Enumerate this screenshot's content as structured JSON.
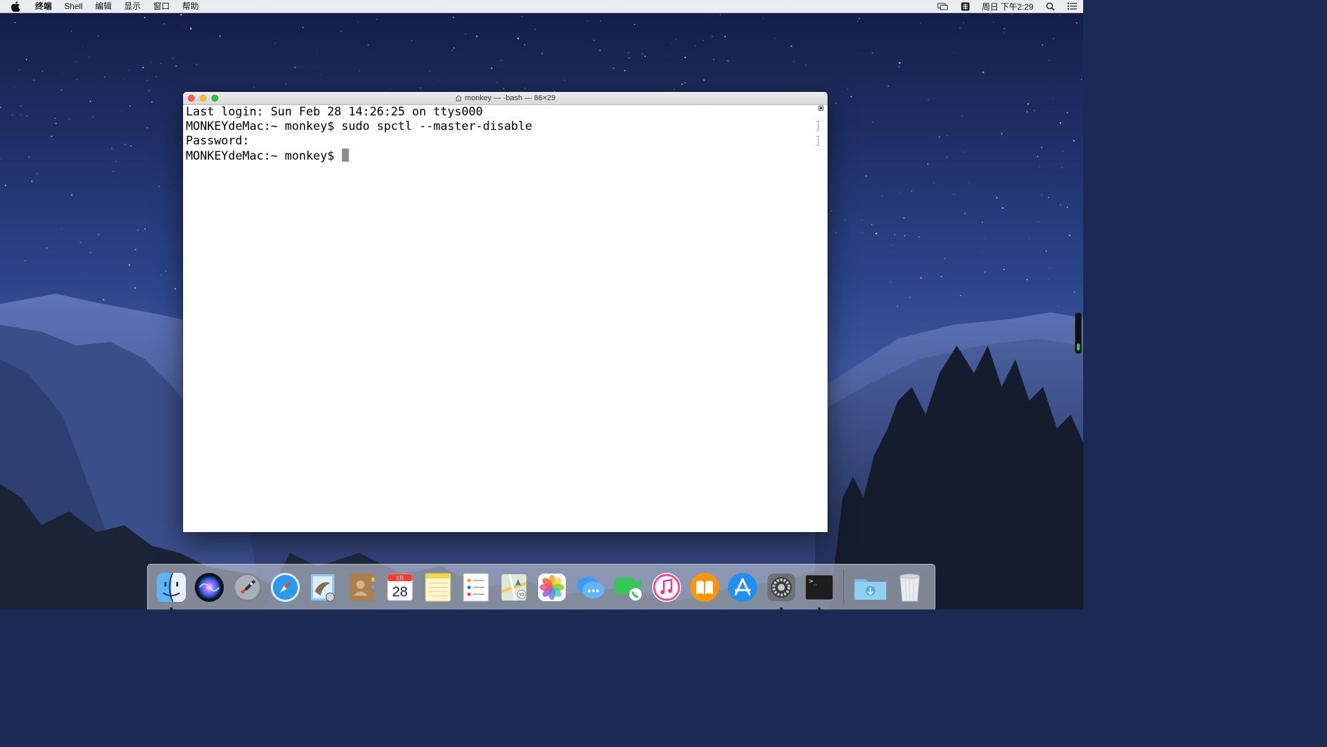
{
  "menubar": {
    "app_name": "终端",
    "menus": [
      "Shell",
      "编辑",
      "显示",
      "窗口",
      "帮助"
    ],
    "clock": "周日 下午2:29",
    "status_icons": [
      "display-mirroring-icon",
      "input-method-icon",
      "spotlight-search-icon",
      "notification-center-icon"
    ]
  },
  "terminal": {
    "title": "monkey — -bash — 86×29",
    "lines": [
      "Last login: Sun Feb 28 14:26:25 on ttys000",
      "MONKEYdeMac:~ monkey$ sudo spctl --master-disable",
      "Password:",
      "MONKEYdeMac:~ monkey$ "
    ]
  },
  "dock": {
    "apps": [
      {
        "name": "Finder",
        "icon": "finder-icon",
        "running": true
      },
      {
        "name": "Siri",
        "icon": "siri-icon",
        "running": false
      },
      {
        "name": "Launchpad",
        "icon": "launchpad-icon",
        "running": false
      },
      {
        "name": "Safari",
        "icon": "safari-icon",
        "running": false
      },
      {
        "name": "Mail",
        "icon": "mail-icon",
        "running": false
      },
      {
        "name": "Contacts",
        "icon": "contacts-icon",
        "running": false
      },
      {
        "name": "Calendar",
        "icon": "calendar-icon",
        "running": false,
        "month": "2月",
        "day": "28"
      },
      {
        "name": "Notes",
        "icon": "notes-icon",
        "running": false
      },
      {
        "name": "Reminders",
        "icon": "reminders-icon",
        "running": false
      },
      {
        "name": "Maps",
        "icon": "maps-icon",
        "running": false,
        "badge": "3D"
      },
      {
        "name": "Photos",
        "icon": "photos-icon",
        "running": false
      },
      {
        "name": "Messages",
        "icon": "messages-icon",
        "running": false
      },
      {
        "name": "FaceTime",
        "icon": "facetime-icon",
        "running": false
      },
      {
        "name": "iTunes",
        "icon": "itunes-icon",
        "running": false
      },
      {
        "name": "iBooks",
        "icon": "ibooks-icon",
        "running": false
      },
      {
        "name": "App Store",
        "icon": "app-store-icon",
        "running": false
      },
      {
        "name": "System Preferences",
        "icon": "system-preferences-icon",
        "running": true
      },
      {
        "name": "Terminal",
        "icon": "terminal-icon",
        "running": true,
        "glyph": ">_"
      }
    ],
    "stacks": [
      {
        "name": "Downloads",
        "icon": "downloads-folder-icon"
      },
      {
        "name": "Trash",
        "icon": "trash-icon"
      }
    ]
  },
  "colors": {
    "close": "#fe5f57",
    "minimize": "#febc2e",
    "zoom": "#28c840",
    "sky_top": "#141f4a",
    "sky_bottom": "#3c5aa0"
  }
}
